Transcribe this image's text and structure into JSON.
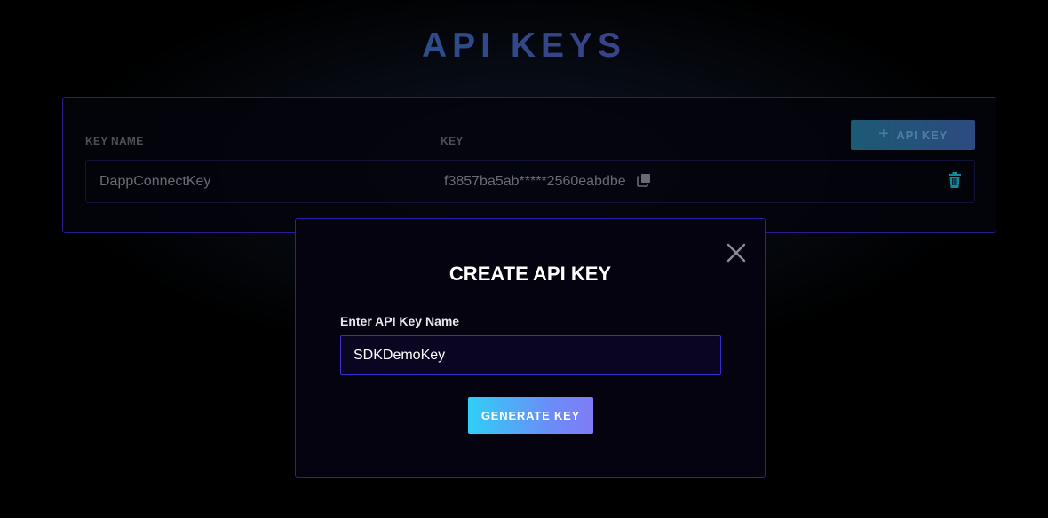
{
  "page": {
    "title": "API KEYS"
  },
  "table": {
    "columns": [
      "KEY NAME",
      "KEY"
    ],
    "add_button_label": "API KEY",
    "rows": [
      {
        "name": "DappConnectKey",
        "key": "f3857ba5ab*****2560eabdbe"
      }
    ]
  },
  "modal": {
    "title": "CREATE API KEY",
    "field_label": "Enter API Key Name",
    "field_value": "SDKDemoKey",
    "generate_button_label": "GENERATE KEY"
  },
  "icons": {
    "add": "plus-icon",
    "copy": "copy-icon",
    "delete": "trash-icon",
    "close": "close-icon"
  },
  "colors": {
    "border_accent": "#2d1cb0",
    "trash": "#0e8a9e",
    "button_gradient_start": "#2fcff6",
    "button_gradient_end": "#7f7cf6"
  }
}
